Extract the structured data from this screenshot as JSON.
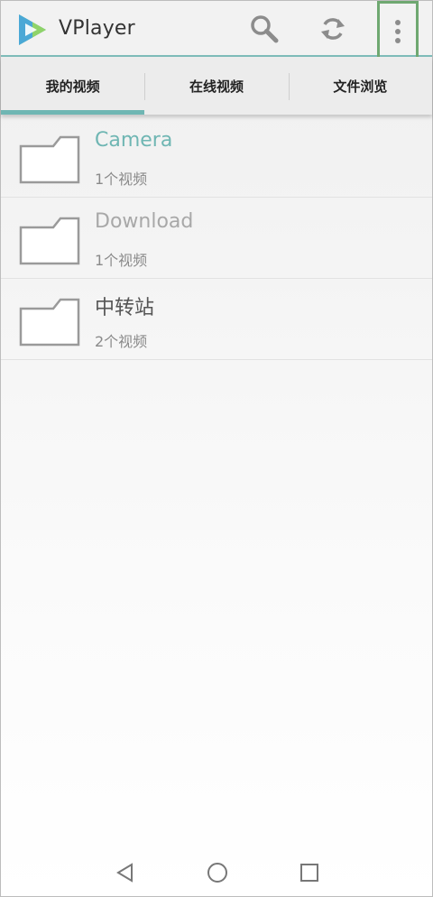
{
  "app": {
    "title": "VPlayer",
    "accent_color": "#6fb6b3"
  },
  "toolbar": {
    "search_icon": "search-icon",
    "refresh_icon": "refresh-icon",
    "menu_icon": "more-vert-icon"
  },
  "tabs": [
    {
      "label": "我的视频",
      "active": true
    },
    {
      "label": "在线视频",
      "active": false
    },
    {
      "label": "文件浏览",
      "active": false
    }
  ],
  "folders": [
    {
      "name": "Camera",
      "count": "1个视频",
      "name_color": "#6fb6b3"
    },
    {
      "name": "Download",
      "count": "1个视频",
      "name_color": "#a8a8a8"
    },
    {
      "name": "中转站",
      "count": "2个视频",
      "name_color": "#555555"
    }
  ],
  "navbar": {
    "back_icon": "back-triangle-icon",
    "home_icon": "home-circle-icon",
    "recents_icon": "recents-square-icon"
  }
}
